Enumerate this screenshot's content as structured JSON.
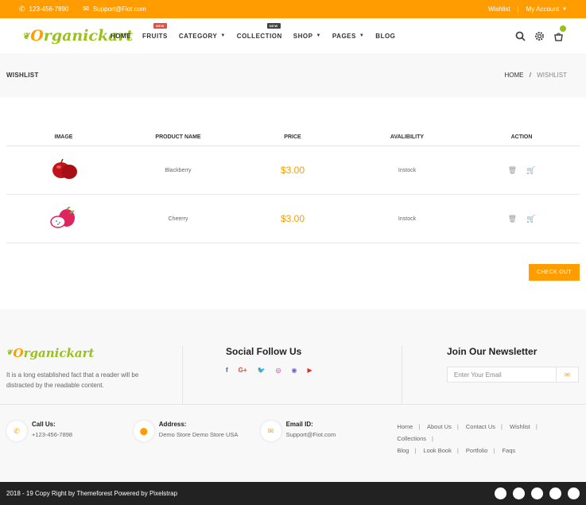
{
  "topbar": {
    "phone": "123-456-7890",
    "email": "Support@Fiot.com",
    "wishlist": "Wishlist",
    "account": "My Account"
  },
  "brand": {
    "logo_first": "O",
    "logo_rest": "rganickart"
  },
  "nav": {
    "items": [
      "HOME",
      "FRUITS",
      "CATEGORY",
      "COLLECTION",
      "SHOP",
      "PAGES",
      "BLOG"
    ],
    "fruits_badge": "NEW",
    "collection_badge": "NEW"
  },
  "page": {
    "title": "WISHLIST",
    "breadcrumb_home": "HOME",
    "breadcrumb_current": "WISHLIST"
  },
  "wishlist": {
    "headers": [
      "IMAGE",
      "PRODUCT NAME",
      "PRICE",
      "AVALIBILITY",
      "ACTION"
    ],
    "rows": [
      {
        "name": "Blackberry",
        "price": "$3.00",
        "availability": "Instock"
      },
      {
        "name": "Cheerry",
        "price": "$3.00",
        "availability": "Instock"
      }
    ],
    "checkout": "CHECK OUT"
  },
  "footer": {
    "about": "It is a long established fact that a reader will be distracted by the readable content.",
    "social_title": "Social Follow Us",
    "newsletter_title": "Join Our Newsletter",
    "newsletter_placeholder": "Enter Your Email",
    "call_label": "Call Us:",
    "call_value": "+123-456-7898",
    "address_label": "Address:",
    "address_value": "Demo Store Demo Store USA",
    "email_label": "Email ID:",
    "email_value": "Support@Fiot.com",
    "links": [
      "Home",
      "About Us",
      "Contact Us",
      "Wishlist",
      "Collections",
      "Blog",
      "Look Book",
      "Portfolio",
      "Faqs"
    ],
    "copyright": "2018 - 19 Copy Right by Themeforest Powered by Pixelstrap"
  },
  "colors": {
    "accent": "#ff9d00",
    "green": "#9ac11b",
    "dark": "#222222"
  }
}
